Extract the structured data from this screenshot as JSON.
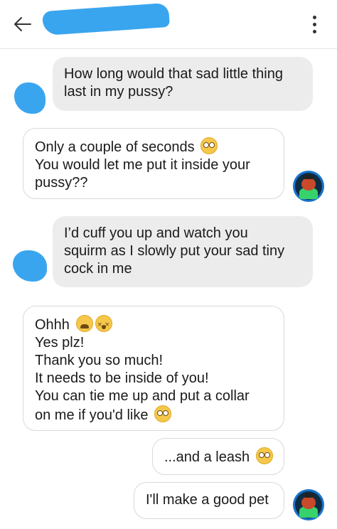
{
  "header": {
    "back_icon": "arrow-left-icon",
    "menu_icon": "more-vertical-icon"
  },
  "messages": [
    {
      "side": "incoming",
      "lines": [
        "How long would that sad little thing",
        "last in my pussy?"
      ]
    },
    {
      "side": "outgoing",
      "lines": [
        "Only a couple of seconds",
        "You would let me put it inside your",
        "pussy??"
      ]
    },
    {
      "side": "incoming",
      "lines": [
        "I’d cuff you up and watch you",
        "squirm as I slowly put your sad tiny",
        "cock in me"
      ]
    },
    {
      "side": "outgoing",
      "lines": [
        "Ohhh",
        "Yes plz!",
        "Thank you so much!",
        "It needs to be inside of you!",
        "You can tie me up and put a collar",
        "on me if you'd like"
      ]
    },
    {
      "side": "outgoing",
      "lines": [
        "...and a leash"
      ]
    },
    {
      "side": "outgoing",
      "lines": [
        "I'll make a good pet"
      ]
    }
  ],
  "emoji": {
    "flushed": "flushed-face",
    "weary": "weary-face",
    "dizzy": "dizzy-face"
  },
  "colors": {
    "redaction": "#3aa5ef",
    "incoming_bubble": "#ececec",
    "outgoing_border": "#d9d9d9"
  }
}
